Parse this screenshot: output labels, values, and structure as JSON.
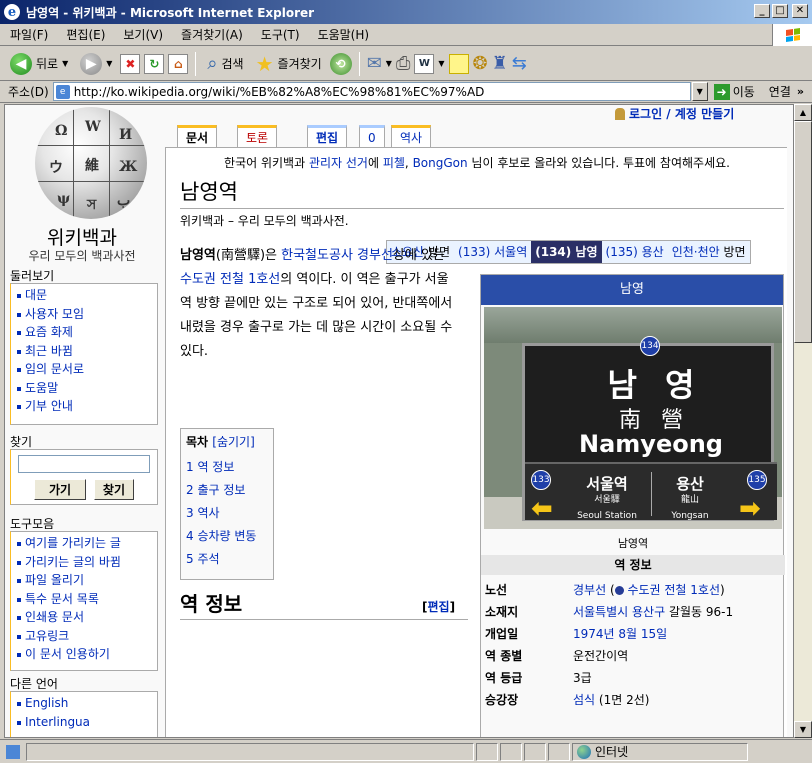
{
  "window": {
    "title": "남영역 - 위키백과 - Microsoft Internet Explorer"
  },
  "menu": [
    "파일(F)",
    "편집(E)",
    "보기(V)",
    "즐겨찾기(A)",
    "도구(T)",
    "도움말(H)"
  ],
  "toolbar": {
    "back_label": "뒤로",
    "search_label": "검색",
    "favorites_label": "즐겨찾기"
  },
  "address": {
    "label": "주소(D)",
    "url": "http://ko.wikipedia.org/wiki/%EB%82%A8%EC%98%81%EC%97%AD",
    "go_label": "이동",
    "links_label": "연결"
  },
  "personal": {
    "login": "로그인 / 계정 만들기"
  },
  "tabs": [
    {
      "label": "문서"
    },
    {
      "label": "토론"
    },
    {
      "label": "편집"
    },
    {
      "label": "0"
    },
    {
      "label": "역사"
    }
  ],
  "sidebar": {
    "logo_title": "위키백과",
    "logo_subtitle": "우리 모두의 백과사전",
    "navigation_heading": "둘러보기",
    "navigation": [
      "대문",
      "사용자 모임",
      "요즘 화제",
      "최근 바뀜",
      "임의 문서로",
      "도움말",
      "기부 안내"
    ],
    "search_heading": "찾기",
    "search_go": "가기",
    "search_find": "찾기",
    "toolbox_heading": "도구모음",
    "toolbox": [
      "여기를 가리키는 글",
      "가리키는 글의 바뀜",
      "파일 올리기",
      "특수 문서 목록",
      "인쇄용 문서",
      "고유링크",
      "이 문서 인용하기"
    ],
    "languages_heading": "다른 언어",
    "languages": [
      "English",
      "Interlingua"
    ]
  },
  "notice": {
    "before": "한국어 위키백과 ",
    "link1": "관리자 선거",
    "middle": "에 ",
    "link2": "피첼",
    "comma": ", ",
    "link3": "BongGon",
    "after": " 님이 후보로 올라와 있습니다. 투표에 참여해주세요."
  },
  "article": {
    "title": "남영역",
    "site_sub": "위키백과 – 우리 모두의 백과사전.",
    "lead_bold": "남영역",
    "lead_hanja": "(南營驛)은 ",
    "lead_link1": "한국철도공사 경부선",
    "lead_mid": "상에 있는 ",
    "lead_link2": "수도권 전철 1호선",
    "lead_rest": "의 역이다. 이 역은 출구가 서울역 방향 끝에만 있는 구조로 되어 있어, 반대쪽에서 내렸을 경우 출구로 가는 데 많은 시간이 소요될 수 있다.",
    "section_title": "역 정보",
    "section_edit": "편집"
  },
  "station_nav": {
    "prev2_line": "소요산",
    "prev2_dir": " 방면",
    "prev": "(133) 서울역",
    "current": "(134) 남영",
    "next": "(135) 용산",
    "next2_line": "인천·천안",
    "next2_dir": " 방면"
  },
  "toc": {
    "title": "목차",
    "toggle": "[숨기기]",
    "items": [
      "1 역 정보",
      "2 출구 정보",
      "3 역사",
      "4 승차량 변동",
      "5 주석"
    ]
  },
  "infobox": {
    "header": "남영",
    "caption": "남영역",
    "subheader": "역 정보",
    "sign": {
      "number": "134",
      "korean": "남영",
      "hanja": "南營",
      "english": "Namyeong",
      "left_num": "133",
      "left_ko": "서울역",
      "left_hanja": "서울驛",
      "left_en": "Seoul Station",
      "right_num": "135",
      "right_ko": "용산",
      "right_hanja": "龍山",
      "right_en": "Yongsan"
    },
    "rows": [
      {
        "key": "노선",
        "link": "경부선",
        "extra_open": " (",
        "extra_link": "수도권 전철 1호선",
        "extra_close": ")"
      },
      {
        "key": "소재지",
        "link": "서울특별시 용산구",
        "rest": " 갈월동 96-1"
      },
      {
        "key": "개업일",
        "link": "1974년 8월 15일"
      },
      {
        "key": "역 종별",
        "text": "운전간이역"
      },
      {
        "key": "역 등급",
        "text": "3급"
      },
      {
        "key": "승강장",
        "link": "섬식",
        "rest": " (1면 2선)"
      }
    ]
  },
  "status": {
    "zone": "인터넷"
  }
}
